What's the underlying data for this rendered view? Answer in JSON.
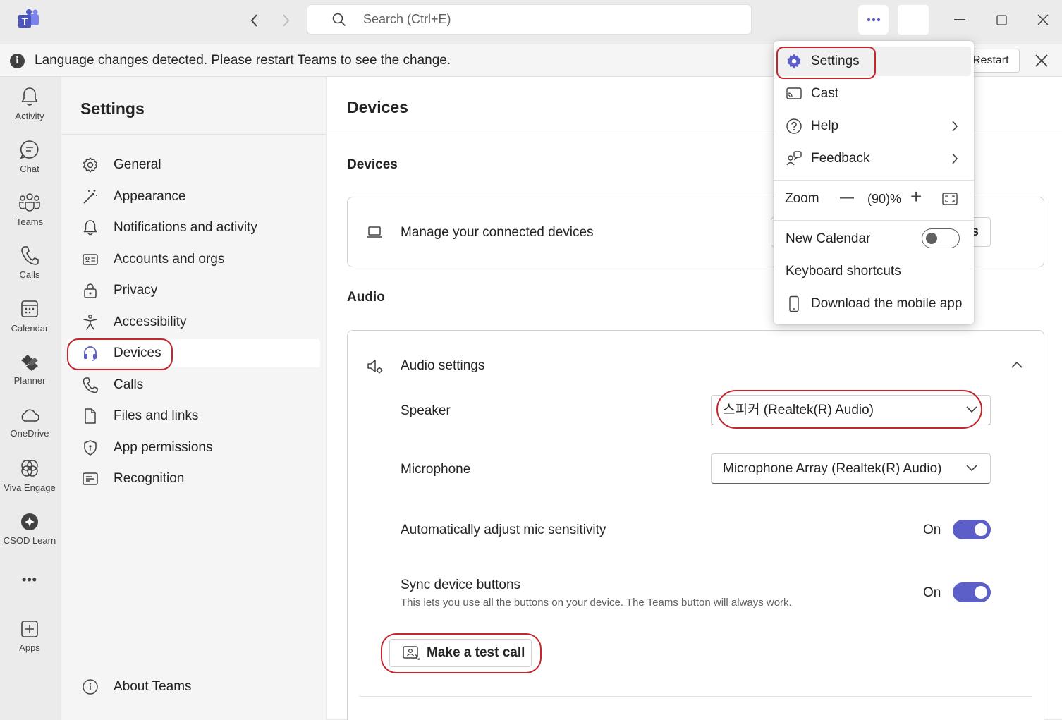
{
  "titlebar": {
    "search_placeholder": "Search (Ctrl+E)"
  },
  "banner": {
    "text": "Language changes detected. Please restart Teams to see the change.",
    "restart_label": "Restart"
  },
  "rail": {
    "items": [
      {
        "label": "Activity",
        "icon": "bell-icon"
      },
      {
        "label": "Chat",
        "icon": "chat-icon"
      },
      {
        "label": "Teams",
        "icon": "teams-icon"
      },
      {
        "label": "Calls",
        "icon": "phone-icon"
      },
      {
        "label": "Calendar",
        "icon": "calendar-icon"
      },
      {
        "label": "Planner",
        "icon": "planner-icon"
      },
      {
        "label": "OneDrive",
        "icon": "cloud-icon"
      },
      {
        "label": "Viva Engage",
        "icon": "viva-engage-icon"
      },
      {
        "label": "CSOD Learn",
        "icon": "csod-learn-icon"
      },
      {
        "label": "Apps",
        "icon": "add-apps-icon"
      }
    ],
    "more": "•••"
  },
  "settings_nav": {
    "title": "Settings",
    "items": [
      {
        "label": "General",
        "icon": "gear-icon"
      },
      {
        "label": "Appearance",
        "icon": "wand-icon"
      },
      {
        "label": "Notifications and activity",
        "icon": "bell-icon"
      },
      {
        "label": "Accounts and orgs",
        "icon": "id-card-icon"
      },
      {
        "label": "Privacy",
        "icon": "lock-icon"
      },
      {
        "label": "Accessibility",
        "icon": "accessibility-icon"
      },
      {
        "label": "Devices",
        "icon": "headset-icon",
        "active": true
      },
      {
        "label": "Calls",
        "icon": "phone-icon"
      },
      {
        "label": "Files and links",
        "icon": "file-icon"
      },
      {
        "label": "App permissions",
        "icon": "shield-icon"
      },
      {
        "label": "Recognition",
        "icon": "recognition-icon"
      }
    ],
    "about": "About Teams"
  },
  "main": {
    "title": "Devices",
    "devices_heading": "Devices",
    "manage_devices": "Manage your connected devices",
    "manage_button_visible": "s",
    "audio_heading": "Audio",
    "audio_settings": "Audio settings",
    "speaker_label": "Speaker",
    "speaker_value": "스피커 (Realtek(R) Audio)",
    "microphone_label": "Microphone",
    "microphone_value": "Microphone Array (Realtek(R) Audio)",
    "mic_sensitivity_label": "Automatically adjust mic sensitivity",
    "mic_sensitivity_state": "On",
    "sync_label": "Sync device buttons",
    "sync_desc": "This lets you use all the buttons on your device. The Teams button will always work.",
    "sync_state": "On",
    "test_call": "Make a test call"
  },
  "menu": {
    "settings": "Settings",
    "cast": "Cast",
    "help": "Help",
    "feedback": "Feedback",
    "zoom_label": "Zoom",
    "zoom_minus": "—",
    "zoom_value": "(90)%",
    "zoom_plus": "+",
    "new_calendar": "New Calendar",
    "new_calendar_on": false,
    "keyboard_shortcuts": "Keyboard shortcuts",
    "download_mobile": "Download the mobile app"
  },
  "colors": {
    "accent": "#5b5fc7",
    "highlight_ring": "#c4262e"
  }
}
